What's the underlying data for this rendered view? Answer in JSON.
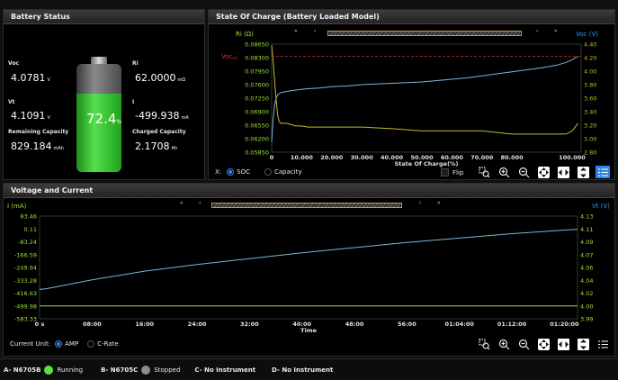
{
  "battery_panel": {
    "title": "Battery Status",
    "voc": {
      "label": "Voc",
      "value": "4.0781",
      "unit": "V"
    },
    "vt": {
      "label": "Vt",
      "value": "4.1091",
      "unit": "V"
    },
    "remaining_capacity": {
      "label": "Remaining Capacity",
      "value": "829.184",
      "unit": "mAh"
    },
    "ri": {
      "label": "Ri",
      "value": "62.0000",
      "unit": "mΩ"
    },
    "current": {
      "label": "I",
      "value": "-499.938",
      "unit": "mA"
    },
    "charged_capacity": {
      "label": "Charged Capacity",
      "value": "2.1708",
      "unit": "Ah"
    },
    "soc_value": "72.4",
    "soc_unit": "%",
    "soc_fraction": 0.724
  },
  "soc_panel": {
    "title": "State Of Charge (Battery Loaded Model)",
    "nav": {
      "first": "«",
      "prev": "‹",
      "next": "›",
      "last": "»"
    },
    "x_selector": {
      "label": "X:",
      "options": [
        "SOC",
        "Capacity"
      ],
      "selected": "SOC"
    },
    "flip_label": "Flip",
    "tools": [
      "zoom-box-icon",
      "zoom-in-icon",
      "zoom-out-icon",
      "pan-icon",
      "fit-horizontal-icon",
      "fit-vertical-icon",
      "legend-icon"
    ],
    "voc_ref_label": "Voc",
    "voc_ref_sub": "ref"
  },
  "vi_panel": {
    "title": "Voltage and Current",
    "nav": {
      "first": "«",
      "prev": "‹",
      "next": "›",
      "last": "»"
    },
    "current_unit": {
      "label": "Current Unit:",
      "options": [
        "AMP",
        "C-Rate"
      ],
      "selected": "AMP"
    },
    "tools": [
      "zoom-box-icon",
      "zoom-in-icon",
      "zoom-out-icon",
      "pan-icon",
      "fit-horizontal-icon",
      "fit-vertical-icon",
      "legend-icon"
    ]
  },
  "status_bar": {
    "channels": [
      {
        "name": "A- N6705B",
        "state": "Running",
        "color": "#5ee23a"
      },
      {
        "name": "B- N6705C",
        "state": "Stopped",
        "color": "#8c8c8c"
      },
      {
        "name": "C- No Instrument",
        "state": "",
        "color": ""
      },
      {
        "name": "D- No Instrument",
        "state": "",
        "color": ""
      }
    ]
  },
  "colors": {
    "accent": "#2f86e6",
    "ri_series": "#c8b82c",
    "voc_series": "#79b6d6",
    "ref_line": "#d03030",
    "axis_green": "#9fe03a",
    "axis_red": "#e05050"
  },
  "chart_data": [
    {
      "type": "line",
      "title": "State Of Charge (Battery Loaded Model)",
      "xlabel": "State Of Charge(%)",
      "ylabel_left": "Ri (Ω)",
      "ylabel_right": "Voc (V)",
      "x_ticks": [
        "0",
        "10.000",
        "20.000",
        "30.000",
        "40.000",
        "50.000",
        "60.000",
        "70.000",
        "80.000",
        "100.000"
      ],
      "x_tick_values": [
        0,
        10,
        20,
        30,
        40,
        50,
        60,
        70,
        80,
        100
      ],
      "y_left_ticks": [
        "0.08650",
        "0.08300",
        "0.07950",
        "0.07600",
        "0.07250",
        "0.06900",
        "0.06550",
        "0.06200",
        "0.05850"
      ],
      "y_right_ticks": [
        "4.40",
        "4.20",
        "4.00",
        "3.80",
        "3.60",
        "3.40",
        "3.20",
        "3.00",
        "2.80"
      ],
      "xlim": [
        0,
        103
      ],
      "ylim_left": [
        0.0585,
        0.0865
      ],
      "ylim_right": [
        2.8,
        4.4
      ],
      "series": [
        {
          "name": "Voc",
          "axis": "right",
          "x": [
            0,
            0.5,
            1,
            1.5,
            2,
            3,
            5,
            8,
            12,
            16,
            20,
            25,
            30,
            35,
            40,
            45,
            50,
            55,
            60,
            65,
            70,
            75,
            80,
            85,
            90,
            95,
            98,
            100,
            102
          ],
          "y": [
            2.95,
            3.3,
            3.5,
            3.6,
            3.65,
            3.68,
            3.7,
            3.72,
            3.74,
            3.75,
            3.77,
            3.78,
            3.8,
            3.81,
            3.82,
            3.83,
            3.84,
            3.86,
            3.88,
            3.9,
            3.93,
            3.96,
            3.99,
            4.02,
            4.05,
            4.09,
            4.13,
            4.17,
            4.22
          ]
        },
        {
          "name": "Ri",
          "axis": "left",
          "x": [
            0,
            0.5,
            1,
            1.5,
            2,
            2.5,
            3,
            5,
            8,
            10,
            12,
            20,
            30,
            40,
            50,
            60,
            70,
            80,
            90,
            98,
            100,
            101,
            102
          ],
          "y": [
            0.0862,
            0.082,
            0.077,
            0.072,
            0.068,
            0.0665,
            0.066,
            0.066,
            0.0653,
            0.0653,
            0.065,
            0.065,
            0.065,
            0.0646,
            0.064,
            0.064,
            0.064,
            0.0632,
            0.0632,
            0.0632,
            0.064,
            0.065,
            0.066
          ]
        }
      ],
      "ref_line": {
        "name": "Voc_ref",
        "axis": "right",
        "y": 4.22
      }
    },
    {
      "type": "line",
      "title": "Voltage and Current",
      "xlabel": "Time",
      "ylabel_left": "I (mA)",
      "ylabel_right": "Vt (V)",
      "x_ticks": [
        "0 s",
        "08:00",
        "16:00",
        "24:00",
        "32:00",
        "40:00",
        "48:00",
        "56:00",
        "01:04:00",
        "01:12:00",
        "01:20:00"
      ],
      "x_tick_values": [
        0,
        8,
        16,
        24,
        32,
        40,
        48,
        56,
        64,
        72,
        80
      ],
      "y_left_ticks": [
        "83.46",
        "0.11",
        "-83.24",
        "-166.59",
        "-249.94",
        "-333.28",
        "-416.63",
        "-499.98",
        "-583.33"
      ],
      "y_right_ticks": [
        "4.13",
        "4.11",
        "4.09",
        "4.07",
        "4.06",
        "4.04",
        "4.02",
        "4.00",
        "3.99"
      ],
      "xlim": [
        0,
        82
      ],
      "ylim_left": [
        -583.33,
        83.46
      ],
      "ylim_right": [
        3.99,
        4.13
      ],
      "series": [
        {
          "name": "Vt",
          "axis": "right",
          "x": [
            0,
            1,
            4,
            8,
            16,
            24,
            32,
            40,
            48,
            56,
            64,
            72,
            80,
            82
          ],
          "y": [
            4.03,
            4.031,
            4.036,
            4.043,
            4.055,
            4.064,
            4.072,
            4.08,
            4.087,
            4.094,
            4.1,
            4.106,
            4.111,
            4.112
          ]
        },
        {
          "name": "I",
          "axis": "left",
          "x": [
            0,
            82
          ],
          "y": [
            -499.94,
            -499.94
          ]
        }
      ]
    }
  ]
}
